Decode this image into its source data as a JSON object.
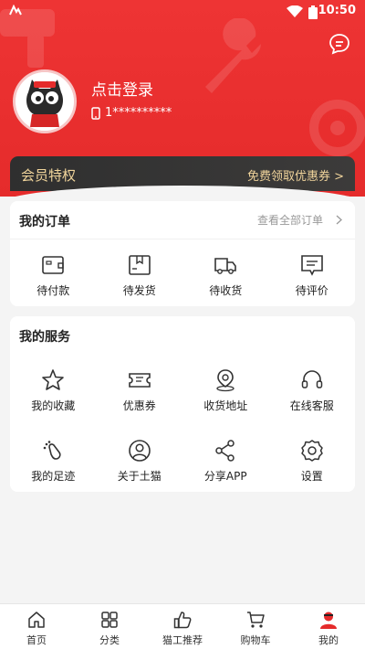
{
  "status_bar": {
    "time": "10:50"
  },
  "header": {
    "login_text": "点击登录",
    "phone": "1**********"
  },
  "member": {
    "title": "会员特权",
    "link_label": "免费领取优惠券 >"
  },
  "orders": {
    "title": "我的订单",
    "view_all_label": "查看全部订单",
    "items": [
      {
        "label": "待付款",
        "icon": "wallet-icon"
      },
      {
        "label": "待发货",
        "icon": "package-icon"
      },
      {
        "label": "待收货",
        "icon": "truck-icon"
      },
      {
        "label": "待评价",
        "icon": "comment-icon"
      }
    ]
  },
  "services": {
    "title": "我的服务",
    "items": [
      {
        "label": "我的收藏",
        "icon": "star-icon"
      },
      {
        "label": "优惠券",
        "icon": "coupon-icon"
      },
      {
        "label": "收货地址",
        "icon": "location-icon"
      },
      {
        "label": "在线客服",
        "icon": "headset-icon"
      },
      {
        "label": "我的足迹",
        "icon": "footprint-icon"
      },
      {
        "label": "关于土猫",
        "icon": "user-circle-icon"
      },
      {
        "label": "分享APP",
        "icon": "share-icon"
      },
      {
        "label": "设置",
        "icon": "settings-icon"
      }
    ]
  },
  "tabbar": {
    "items": [
      {
        "label": "首页",
        "icon": "home-icon"
      },
      {
        "label": "分类",
        "icon": "category-icon"
      },
      {
        "label": "猫工推荐",
        "icon": "thumbs-up-icon"
      },
      {
        "label": "购物车",
        "icon": "cart-icon"
      },
      {
        "label": "我的",
        "icon": "profile-icon",
        "active": true
      }
    ]
  },
  "colors": {
    "brand_red": "#e52b2b",
    "member_gold": "#f0d49b",
    "member_bg": "#333333"
  }
}
